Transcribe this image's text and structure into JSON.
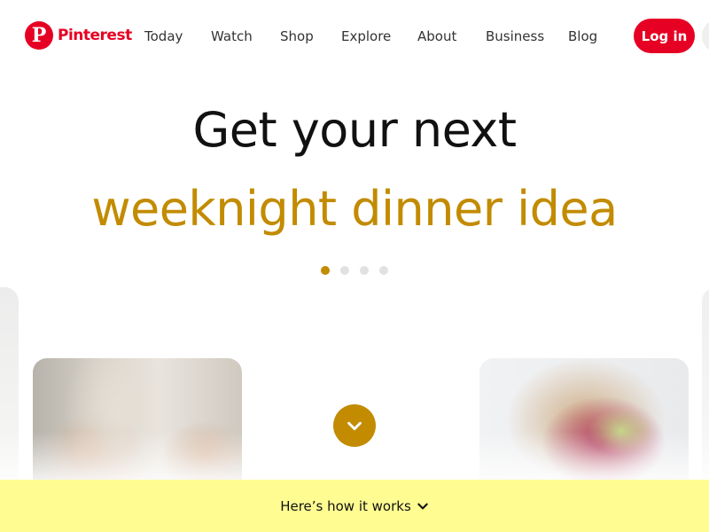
{
  "header": {
    "brand": "Pinterest",
    "nav": [
      {
        "label": "Today"
      },
      {
        "label": "Watch"
      },
      {
        "label": "Shop"
      },
      {
        "label": "Explore"
      },
      {
        "label": "About"
      },
      {
        "label": "Business"
      },
      {
        "label": "Blog"
      }
    ],
    "login_label": "Log in"
  },
  "hero": {
    "line1": "Get your next",
    "line2": "weeknight dinner idea",
    "carousel": {
      "total": 4,
      "active_index": 0
    }
  },
  "footer_bar": {
    "label": "Here’s how it works"
  },
  "colors": {
    "brand_red": "#e60023",
    "accent_gold": "#c28b00",
    "bar_yellow": "#fffd92"
  },
  "icons": {
    "logo": "pinterest-logo-icon",
    "scroll": "chevron-down-icon",
    "how_works": "chevron-down-icon"
  }
}
